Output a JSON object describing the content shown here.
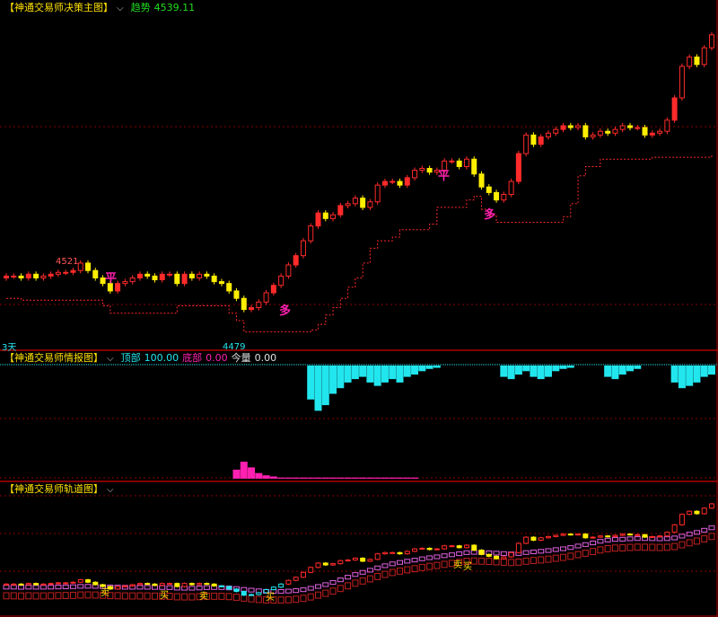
{
  "colors": {
    "bull": "#ff2a2a",
    "bear_red": "#e00000",
    "yellow": "#ffee00",
    "cyan": "#22e6ee",
    "magenta": "#ff20b0",
    "pink_band": "#e060e0",
    "red_band": "#c02020",
    "grid": "#8b0000",
    "trend_green": "#22dd22",
    "frame": "#b00000"
  },
  "panels": {
    "main": {
      "title": "【神通交易师决策主图】",
      "chevron": "⌵",
      "trend_label": "趋势",
      "trend_value": "4539.11",
      "period_label": "3天",
      "high_label": "4521",
      "low_label": "4479",
      "markers": [
        {
          "text": "平",
          "color": "magenta"
        },
        {
          "text": "多",
          "color": "magenta"
        },
        {
          "text": "平",
          "color": "magenta"
        },
        {
          "text": "多",
          "color": "magenta"
        }
      ]
    },
    "info": {
      "title": "【神通交易师情报图】",
      "chevron": "⌵",
      "top_label": "顶部",
      "top_value": "100.00",
      "bottom_label": "底部",
      "bottom_value": "0.00",
      "qty_label": "今量",
      "qty_value": "0.00"
    },
    "track": {
      "title": "【神通交易师轨道图】",
      "chevron": "⌵",
      "signals": [
        "卖",
        "买",
        "卖",
        "买",
        "卖",
        "买"
      ]
    }
  },
  "chart_data": [
    {
      "type": "candlestick",
      "panel": "决策主图",
      "note_colors": "red = up, yellow = down bars",
      "candles_close": [
        4509,
        4509,
        4508,
        4510,
        4508,
        4509,
        4510,
        4511,
        4511,
        4512,
        4516,
        4512,
        4508,
        4505,
        4501,
        4505,
        4506,
        4508,
        4510,
        4509,
        4507,
        4510,
        4510,
        4505,
        4510,
        4508,
        4510,
        4509,
        4506,
        4505,
        4501,
        4497,
        4491,
        4492,
        4495,
        4500,
        4504,
        4509,
        4515,
        4520,
        4528,
        4536,
        4543,
        4540,
        4542,
        4547,
        4548,
        4551,
        4546,
        4549,
        4558,
        4560,
        4560,
        4558,
        4562,
        4566,
        4567,
        4565,
        4566,
        4571,
        4571,
        4568,
        4572,
        4564,
        4557,
        4554,
        4550,
        4553,
        4560,
        4575,
        4585,
        4580,
        4584,
        4586,
        4588,
        4590,
        4589,
        4590,
        4584,
        4585,
        4587,
        4586,
        4588,
        4590,
        4589,
        4589,
        4585,
        4586,
        4587,
        4593,
        4605,
        4622,
        4627,
        4623,
        4632,
        4639
      ],
      "ylabel": "",
      "ylim": [
        4470,
        4650
      ]
    },
    {
      "type": "bar",
      "panel": "情报图",
      "series": [
        {
          "name": "顶部",
          "color": "cyan",
          "values": [
            0,
            0,
            0,
            0,
            0,
            0,
            0,
            0,
            0,
            0,
            0,
            0,
            0,
            0,
            0,
            0,
            0,
            0,
            0,
            0,
            0,
            0,
            0,
            0,
            0,
            0,
            0,
            0,
            0,
            0,
            0,
            0,
            0,
            0,
            0,
            0,
            0,
            0,
            0,
            0,
            0,
            30,
            40,
            35,
            25,
            20,
            15,
            12,
            10,
            15,
            18,
            15,
            12,
            15,
            10,
            8,
            5,
            3,
            2,
            0,
            0,
            0,
            0,
            0,
            0,
            0,
            0,
            10,
            12,
            8,
            5,
            10,
            12,
            10,
            5,
            3,
            2,
            0,
            0,
            0,
            0,
            10,
            12,
            8,
            5,
            3,
            0,
            0,
            0,
            0,
            15,
            20,
            18,
            15,
            10,
            8
          ]
        },
        {
          "name": "底部",
          "color": "magenta",
          "values": [
            0,
            0,
            0,
            0,
            0,
            0,
            0,
            0,
            0,
            0,
            0,
            0,
            0,
            0,
            0,
            0,
            0,
            0,
            0,
            0,
            0,
            0,
            0,
            0,
            0,
            0,
            0,
            0,
            0,
            0,
            0,
            8,
            15,
            10,
            5,
            3,
            2,
            1,
            1,
            1,
            1,
            1,
            1,
            1,
            1,
            1,
            1,
            1,
            1,
            1,
            1,
            1,
            1,
            1,
            1,
            1,
            0,
            0,
            0,
            0,
            0,
            0,
            0,
            0,
            0,
            0,
            0,
            0,
            0,
            0,
            0,
            0,
            0,
            0,
            0,
            0,
            0,
            0,
            0,
            0,
            0,
            0,
            0,
            0,
            0,
            0,
            0,
            0,
            0,
            0,
            0,
            0,
            0,
            0,
            0,
            0
          ]
        }
      ],
      "ylim": [
        0,
        100
      ]
    },
    {
      "type": "candlestick",
      "panel": "轨道图",
      "note": "same price series with two channel bands (pink upper track, dark-red lower track)",
      "ylim": [
        4470,
        4650
      ]
    }
  ]
}
